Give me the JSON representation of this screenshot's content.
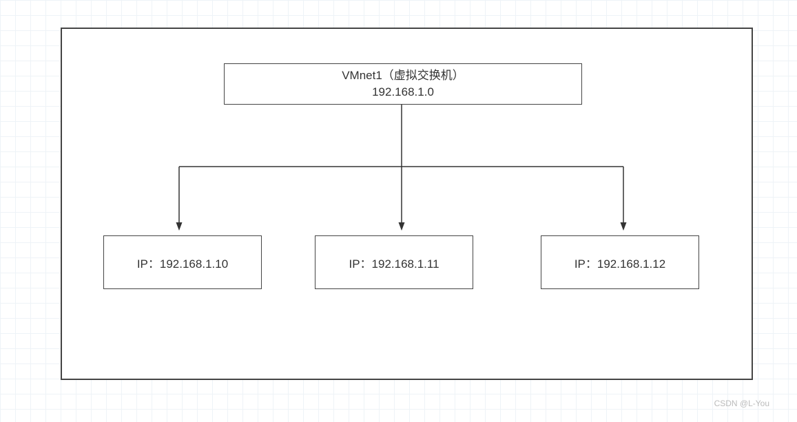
{
  "diagram": {
    "switch": {
      "title": "VMnet1（虚拟交换机）",
      "subnet": "192.168.1.0"
    },
    "nodes": [
      {
        "label": "IP：192.168.1.10"
      },
      {
        "label": "IP：192.168.1.11"
      },
      {
        "label": "IP：192.168.1.12"
      }
    ]
  },
  "watermark": "CSDN @L-You"
}
